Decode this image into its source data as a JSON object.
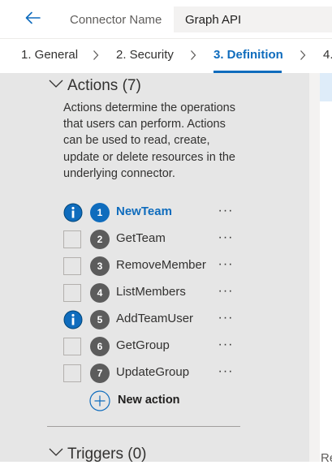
{
  "header": {
    "back_icon": "back-arrow-icon",
    "connector_label": "Connector Name",
    "connector_value": "Graph API"
  },
  "tabs": [
    {
      "label": "1. General",
      "active": false
    },
    {
      "label": "2. Security",
      "active": false
    },
    {
      "label": "3. Definition",
      "active": true
    },
    {
      "label": "4.",
      "active": false
    }
  ],
  "actions_section": {
    "title": "Actions (7)",
    "description": "Actions determine the operations that users can perform. Actions can be used to read, create, update or delete resources in the underlying connector.",
    "items": [
      {
        "number": "1",
        "name": "NewTeam",
        "has_info": true,
        "active": true,
        "more": "···"
      },
      {
        "number": "2",
        "name": "GetTeam",
        "has_info": false,
        "active": false,
        "more": "···"
      },
      {
        "number": "3",
        "name": "RemoveMember",
        "has_info": false,
        "active": false,
        "more": "···"
      },
      {
        "number": "4",
        "name": "ListMembers",
        "has_info": false,
        "active": false,
        "more": "···"
      },
      {
        "number": "5",
        "name": "AddTeamUser",
        "has_info": true,
        "active": false,
        "more": "···"
      },
      {
        "number": "6",
        "name": "GetGroup",
        "has_info": false,
        "active": false,
        "more": "···"
      },
      {
        "number": "7",
        "name": "UpdateGroup",
        "has_info": false,
        "active": false,
        "more": "···"
      }
    ],
    "new_action_label": "New action"
  },
  "triggers_section": {
    "title": "Triggers (0)"
  },
  "right_panel": {
    "partial_text": "Re"
  },
  "colors": {
    "accent": "#0f6cbd",
    "panel_bg": "#e6e6e6",
    "badge_gray": "#5c5c5c"
  }
}
